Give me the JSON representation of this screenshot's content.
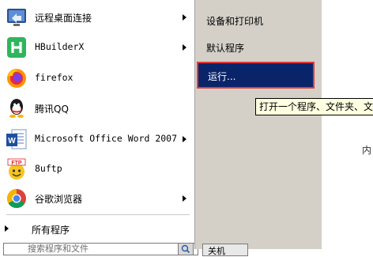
{
  "programs": [
    {
      "label": "远程桌面连接",
      "icon": "remote-desktop-icon",
      "has_arrow": true
    },
    {
      "label": "HBuilderX",
      "icon": "hbuilderx-icon",
      "has_arrow": true
    },
    {
      "label": "firefox",
      "icon": "firefox-icon",
      "has_arrow": false
    },
    {
      "label": "腾讯QQ",
      "icon": "qq-icon",
      "has_arrow": false
    },
    {
      "label": "Microsoft Office Word 2007",
      "icon": "word-icon",
      "has_arrow": true
    },
    {
      "label": "8uftp",
      "icon": "ftp-icon",
      "has_arrow": false
    },
    {
      "label": "谷歌浏览器",
      "icon": "chrome-icon",
      "has_arrow": true
    }
  ],
  "all_programs": "所有程序",
  "search": {
    "text": "搜索程序和文件"
  },
  "right_items": {
    "devices": "设备和打印机",
    "defaults": "默认程序",
    "run": "运行..."
  },
  "tooltip": "打开一个程序、文件夹、文",
  "shutdown_label": "关机",
  "background_text": "内"
}
